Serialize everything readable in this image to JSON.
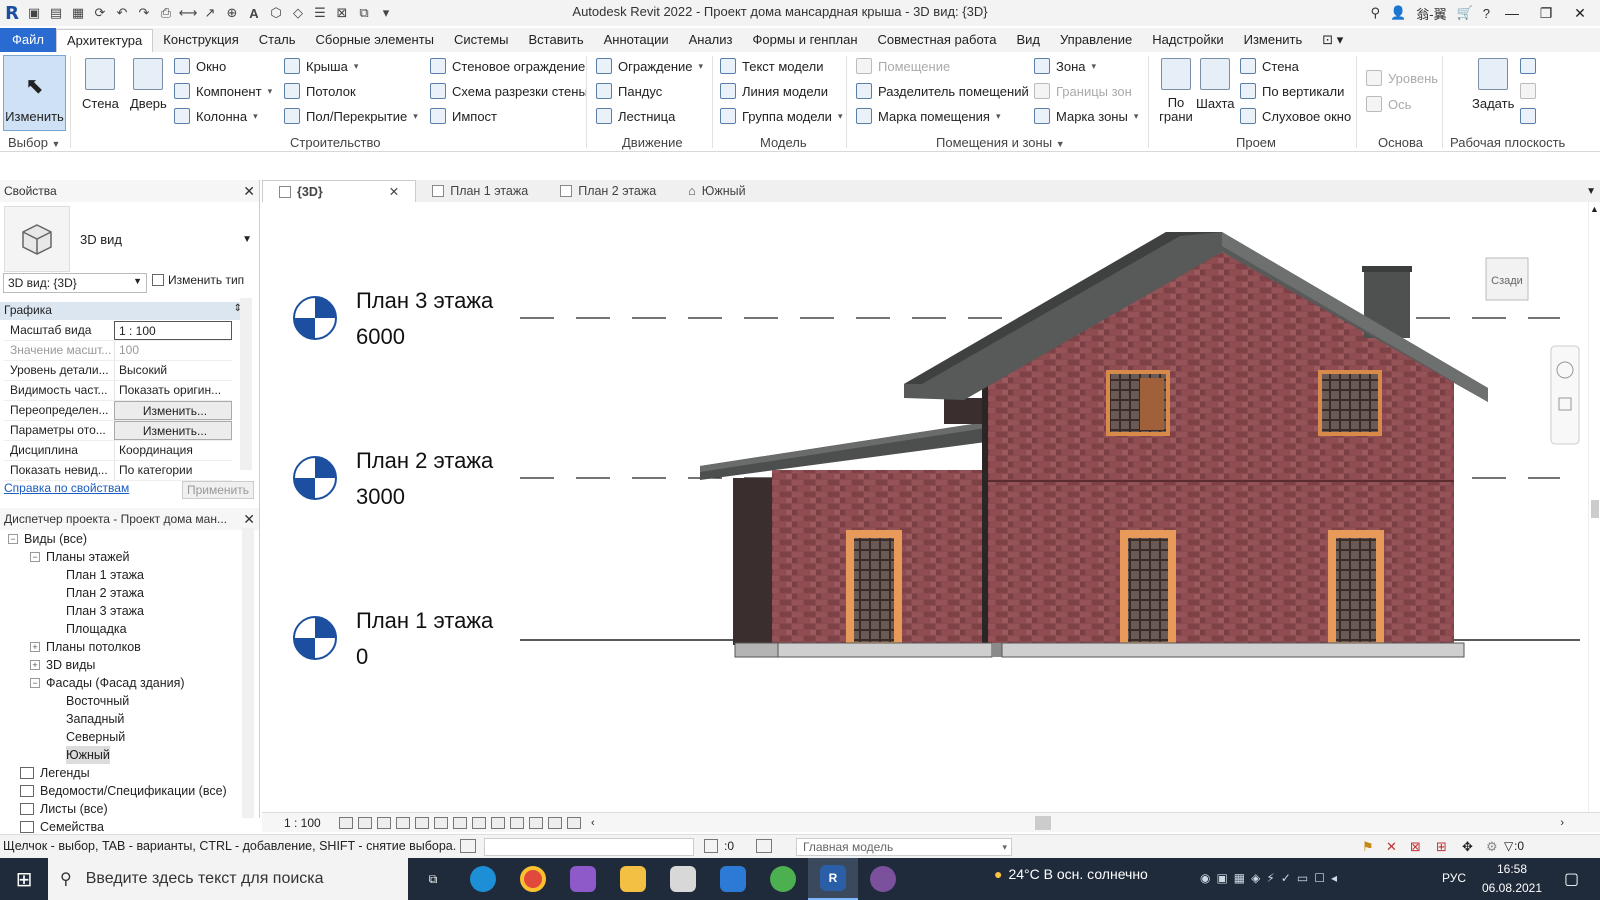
{
  "window": {
    "title": "Autodesk Revit 2022 - Проект дома мансардная крыша - 3D вид: {3D}",
    "user": "翁-翼"
  },
  "menu_tabs": [
    "Файл",
    "Архитектура",
    "Конструкция",
    "Сталь",
    "Сборные элементы",
    "Системы",
    "Вставить",
    "Аннотации",
    "Анализ",
    "Формы и генплан",
    "Совместная работа",
    "Вид",
    "Управление",
    "Надстройки",
    "Изменить"
  ],
  "ribbon": {
    "select": {
      "label": "Изменить",
      "panel": "Выбор"
    },
    "build": {
      "wall": "Стена",
      "door": "Дверь",
      "window": "Окно",
      "component": "Компонент",
      "column": "Колонна",
      "roof": "Крыша",
      "ceiling": "Потолок",
      "floor": "Пол/Перекрытие",
      "curtain_system": "Стеновое ограждение",
      "curtain_grid": "Схема разрезки стены",
      "mullion": "Импост",
      "panel": "Строительство"
    },
    "circulation": {
      "railing": "Ограждение",
      "ramp": "Пандус",
      "stair": "Лестница",
      "panel": "Движение"
    },
    "model": {
      "model_text": "Текст модели",
      "model_line": "Линия модели",
      "model_group": "Группа модели",
      "panel": "Модель"
    },
    "room": {
      "room": "Помещение",
      "room_separator": "Разделитель помещений",
      "room_tag": "Марка помещения",
      "area": "Зона",
      "area_boundary": "Границы зон",
      "area_tag": "Марка зоны",
      "panel": "Помещения и зоны"
    },
    "opening": {
      "by_face": "По грани",
      "shaft": "Шахта",
      "wall": "Стена",
      "vertical": "По вертикали",
      "dormer": "Слуховое окно",
      "panel": "Проем"
    },
    "datum": {
      "level": "Уровень",
      "grid": "Ось",
      "panel": "Основа"
    },
    "workplane": {
      "set": "Задать",
      "panel": "Рабочая плоскость"
    }
  },
  "properties": {
    "title": "Свойства",
    "type_name": "3D вид",
    "view_selector": "3D вид: {3D}",
    "change_type": "Изменить тип",
    "group": "Графика",
    "rows": [
      {
        "name": "Масштаб вида",
        "value": "1 : 100"
      },
      {
        "name": "Значение масшт...",
        "value": "100"
      },
      {
        "name": "Уровень детали...",
        "value": "Высокий"
      },
      {
        "name": "Видимость част...",
        "value": "Показать оригин..."
      },
      {
        "name": "Переопределен...",
        "value": "Изменить..."
      },
      {
        "name": "Параметры ото...",
        "value": "Изменить..."
      },
      {
        "name": "Дисциплина",
        "value": "Координация"
      },
      {
        "name": "Показать невид...",
        "value": "По категории"
      }
    ],
    "help_link": "Справка по свойствам",
    "apply": "Применить"
  },
  "browser": {
    "title": "Диспетчер проекта - Проект дома ман...",
    "items": [
      {
        "label": "Виды (все)",
        "level": 0,
        "exp": "−"
      },
      {
        "label": "Планы этажей",
        "level": 1,
        "exp": "−"
      },
      {
        "label": "План 1 этажа",
        "level": 2
      },
      {
        "label": "План 2 этажа",
        "level": 2
      },
      {
        "label": "План 3 этажа",
        "level": 2
      },
      {
        "label": "Площадка",
        "level": 2
      },
      {
        "label": "Планы потолков",
        "level": 1,
        "exp": "+"
      },
      {
        "label": "3D виды",
        "level": 1,
        "exp": "+"
      },
      {
        "label": "Фасады (Фасад здания)",
        "level": 1,
        "exp": "−"
      },
      {
        "label": "Восточный",
        "level": 2
      },
      {
        "label": "Западный",
        "level": 2
      },
      {
        "label": "Северный",
        "level": 2
      },
      {
        "label": "Южный",
        "level": 2,
        "selected": true
      },
      {
        "label": "Легенды",
        "level": 0
      },
      {
        "label": "Ведомости/Спецификации (все)",
        "level": 0
      },
      {
        "label": "Листы (все)",
        "level": 0
      },
      {
        "label": "Семейства",
        "level": 0
      }
    ]
  },
  "view_tabs": [
    {
      "label": "{3D}",
      "active": true
    },
    {
      "label": "План 1 этажа"
    },
    {
      "label": "План 2 этажа"
    },
    {
      "label": "Южный"
    }
  ],
  "levels": [
    {
      "name": "План 3 этажа",
      "elevation": "6000"
    },
    {
      "name": "План 2 этажа",
      "elevation": "3000"
    },
    {
      "name": "План 1 этажа",
      "elevation": "0"
    }
  ],
  "viewcube_label": "Сзади",
  "view_control": {
    "scale": "1 : 100"
  },
  "status": {
    "hint": "Щелчок - выбор, TAB - варианты, CTRL - добавление, SHIFT - снятие выбора.",
    "selected": ":0",
    "model": "Главная модель",
    "filter": ":0"
  },
  "taskbar": {
    "search_placeholder": "Введите здесь текст для поиска",
    "weather": "24°C  В осн. солнечно",
    "lang": "РУС",
    "time": "16:58",
    "date": "06.08.2021"
  },
  "colors": {
    "accent": "#2a6bd1",
    "brick": "#8a4a4f",
    "roof": "#575a58",
    "door": "#e79a5a"
  }
}
